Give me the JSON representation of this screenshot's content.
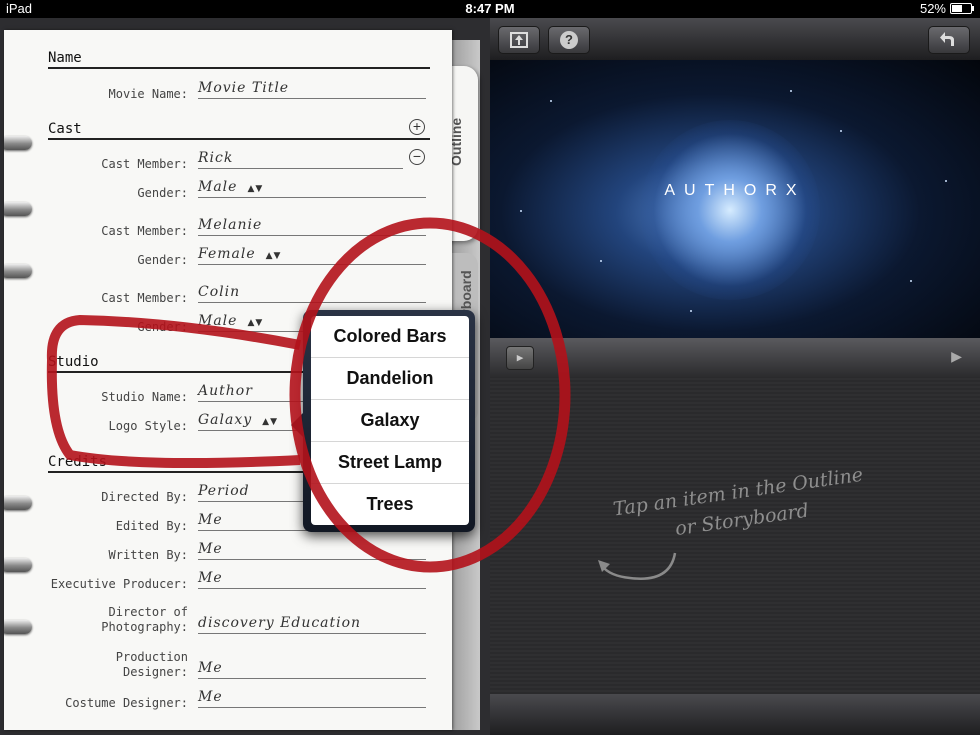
{
  "statusbar": {
    "device": "iPad",
    "time": "8:47 PM",
    "battery": "52%"
  },
  "notebook": {
    "tabs": {
      "outline": "Outline",
      "storyboard": "Storyboard"
    },
    "sections": {
      "name": {
        "heading": "Name",
        "fields": [
          {
            "label": "Movie Name:",
            "value": "Movie Title"
          }
        ]
      },
      "cast": {
        "heading": "Cast",
        "members": [
          {
            "member_label": "Cast Member:",
            "member": "Rick",
            "gender_label": "Gender:",
            "gender": "Male"
          },
          {
            "member_label": "Cast Member:",
            "member": "Melanie",
            "gender_label": "Gender:",
            "gender": "Female"
          },
          {
            "member_label": "Cast Member:",
            "member": "Colin",
            "gender_label": "Gender:",
            "gender": "Male"
          }
        ]
      },
      "studio": {
        "heading": "Studio",
        "fields": [
          {
            "label": "Studio Name:",
            "value": "Author"
          },
          {
            "label": "Logo Style:",
            "value": "Galaxy"
          }
        ]
      },
      "credits": {
        "heading": "Credits",
        "fields": [
          {
            "label": "Directed By:",
            "value": "Period"
          },
          {
            "label": "Edited By:",
            "value": "Me"
          },
          {
            "label": "Written By:",
            "value": "Me"
          },
          {
            "label": "Executive Producer:",
            "value": "Me"
          },
          {
            "label": "Director of Photography:",
            "value": "discovery Education"
          },
          {
            "label": "Production Designer:",
            "value": "Me"
          },
          {
            "label": "Costume Designer:",
            "value": "Me"
          }
        ]
      }
    }
  },
  "preview": {
    "title": "AUTHORX"
  },
  "toolbar": {
    "help": "?"
  },
  "info": {
    "hint": "Tap an item in the Outline or Storyboard"
  },
  "popover": {
    "options": [
      "Colored Bars",
      "Dandelion",
      "Galaxy",
      "Street Lamp",
      "Trees"
    ]
  }
}
